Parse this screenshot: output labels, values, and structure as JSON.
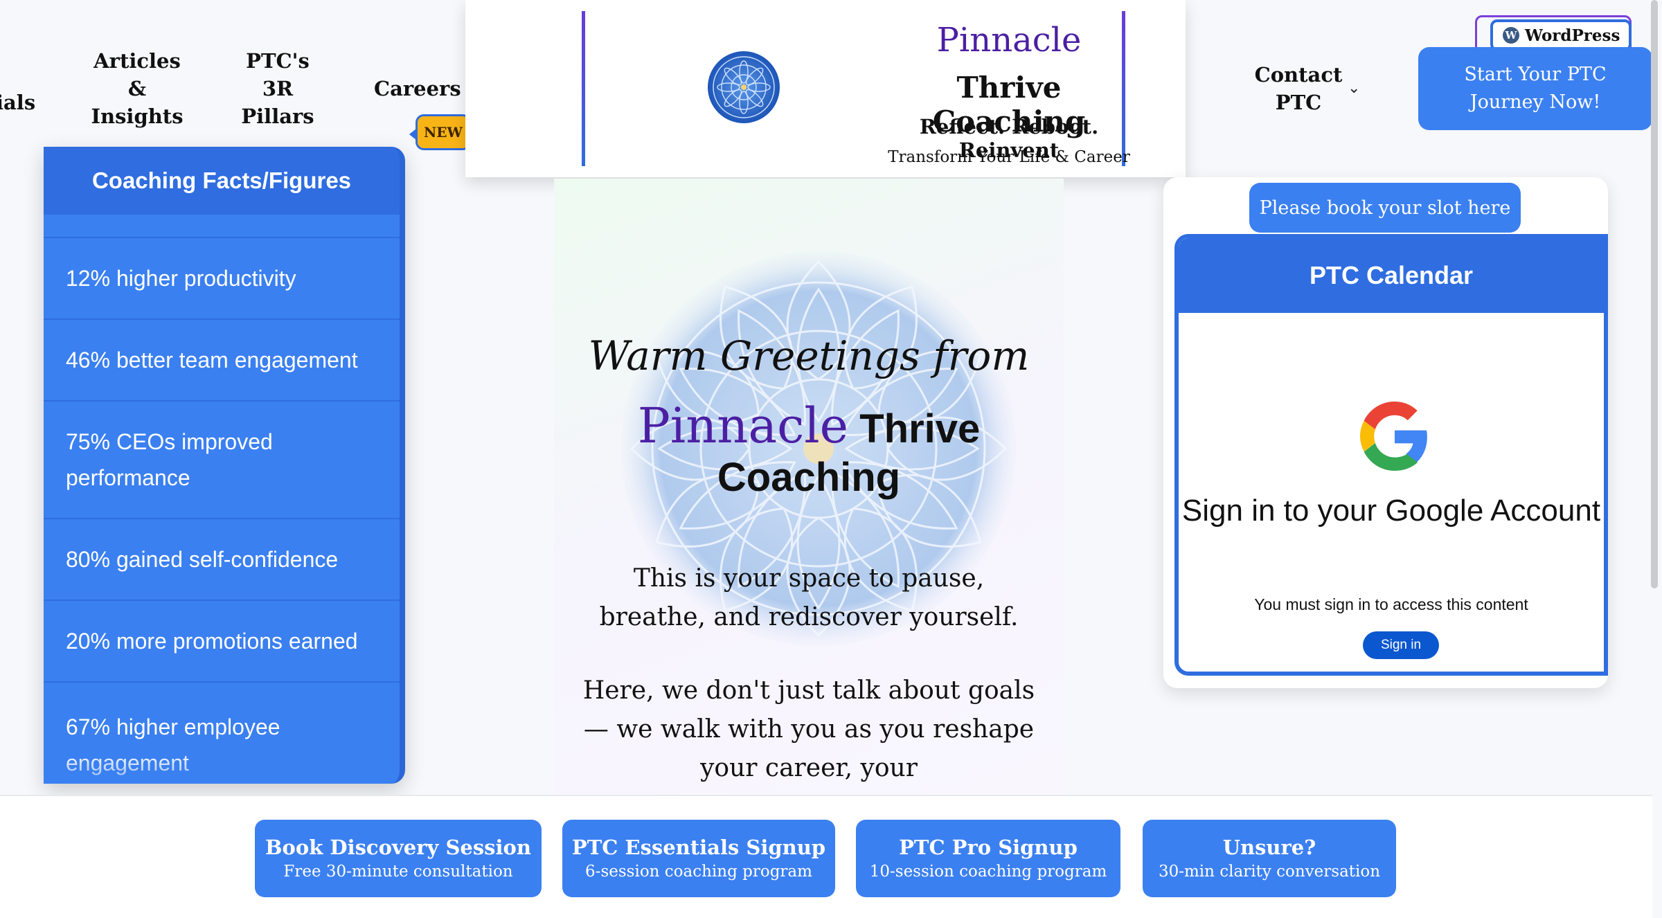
{
  "nav": {
    "partial_item": "ials",
    "articles": "Articles\n&\nInsights",
    "pillars": "PTC's\n3R\nPillars",
    "careers": "Careers",
    "new_badge": "NEW",
    "contact": "Contact\nPTC",
    "wordpress": "WordPress",
    "cta": "Start Your PTC\nJourney Now!"
  },
  "brand": {
    "name_1": "Pinnacle",
    "name_2": "Thrive Coaching",
    "tagline": "Reflect. Reboot. Reinvent",
    "subtitle": "Transform Your Life & Career"
  },
  "facts": {
    "title": "Coaching Facts/Figures",
    "items": [
      "12% higher productivity",
      "46% better team engagement",
      "75% CEOs improved performance",
      "80% gained self-confidence",
      "20% more promotions earned",
      "67% higher employee engagement"
    ]
  },
  "hero": {
    "greeting": "Warm Greetings from",
    "brand_a": "Pinnacle",
    "brand_b": "Thrive",
    "brand_c": "Coaching",
    "para_1": "This is your space to pause, breathe, and rediscover yourself.",
    "para_2": "Here, we don't just talk about goals — we walk with you as you reshape your career, your"
  },
  "calendar": {
    "book_slot": "Please book your slot here",
    "title": "PTC Calendar",
    "signin_title": "Sign in to your Google Account",
    "signin_sub": "You must sign in to access this content",
    "signin_button": "Sign in"
  },
  "bottom_buttons": [
    {
      "title": "Book Discovery Session",
      "sub": "Free 30-minute consultation"
    },
    {
      "title": "PTC Essentials Signup",
      "sub": "6-session coaching program"
    },
    {
      "title": "PTC Pro Signup",
      "sub": "10-session coaching program"
    },
    {
      "title": "Unsure?",
      "sub": "30-min clarity conversation"
    }
  ],
  "colors": {
    "accent": "#3b80f0",
    "accent_dark": "#2f6de0",
    "brand_purple": "#4b1fa3",
    "badge_yellow": "#f8b417"
  },
  "icons": [
    "mandala-logo-icon",
    "wordpress-icon",
    "chevron-down-icon",
    "google-g-icon"
  ]
}
